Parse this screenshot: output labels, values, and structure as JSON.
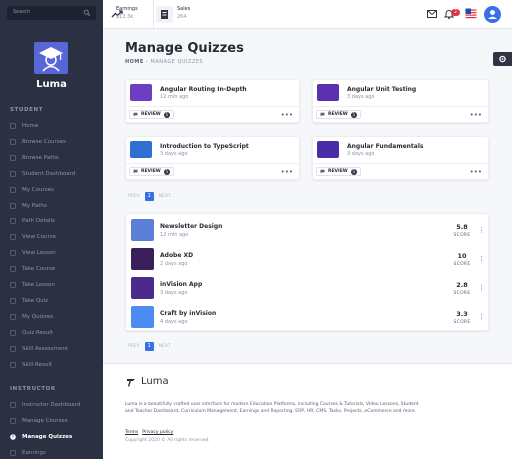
{
  "search": {
    "placeholder": "Search"
  },
  "brand": {
    "name": "Luma"
  },
  "sidebar": {
    "student_section": "STUDENT",
    "student_items": [
      {
        "label": "Home",
        "icon": "home-icon"
      },
      {
        "label": "Browse Courses",
        "icon": "local-library-icon"
      },
      {
        "label": "Browse Paths",
        "icon": "style-icon"
      },
      {
        "label": "Student Dashboard",
        "icon": "account-box-icon"
      },
      {
        "label": "My Courses",
        "icon": "search-icon"
      },
      {
        "label": "My Paths",
        "icon": "timeline-icon"
      },
      {
        "label": "Path Details",
        "icon": "change-history-icon"
      },
      {
        "label": "View Course",
        "icon": "face-icon"
      },
      {
        "label": "View Lesson",
        "icon": "panorama-fish-eye-icon"
      },
      {
        "label": "Take Course",
        "icon": "class-icon"
      },
      {
        "label": "Take Lesson",
        "icon": "import-contacts-icon"
      },
      {
        "label": "Take Quiz",
        "icon": "dvr-icon"
      },
      {
        "label": "My Quizzes",
        "icon": "poll-icon"
      },
      {
        "label": "Quiz Result",
        "icon": "live-help-icon"
      },
      {
        "label": "Skill Assessment",
        "icon": "layers-icon"
      },
      {
        "label": "Skill Result",
        "icon": "assignment-turned-in-icon"
      }
    ],
    "instructor_section": "INSTRUCTOR",
    "instructor_items": [
      {
        "label": "Instructor Dashboard",
        "icon": "school-icon",
        "active": false
      },
      {
        "label": "Manage Courses",
        "icon": "import-contacts-icon",
        "active": false
      },
      {
        "label": "Manage Quizzes",
        "icon": "help-icon",
        "active": true
      },
      {
        "label": "Earnings",
        "icon": "trending-up-icon",
        "active": false
      }
    ]
  },
  "topbar": {
    "earnings_label": "Earnings",
    "earnings_value": "$12.3k",
    "sales_label": "Sales",
    "sales_value": "264",
    "notifications_count": "2"
  },
  "page": {
    "title": "Manage Quizzes",
    "breadcrumb_home": "HOME",
    "breadcrumb_sep": " › ",
    "breadcrumb_current": "MANAGE QUIZZES"
  },
  "cards": [
    {
      "title": "Angular Routing In-Depth",
      "sub": "12 min ago",
      "review": "REVIEW",
      "count": "5",
      "thumb_color": "#6c3ec2"
    },
    {
      "title": "Angular Unit Testing",
      "sub": "3 days ago",
      "review": "REVIEW",
      "count": "5",
      "thumb_color": "#5a2fb0"
    },
    {
      "title": "Introduction to TypeScript",
      "sub": "3 days ago",
      "review": "REVIEW",
      "count": "5",
      "thumb_color": "#2f6fd3"
    },
    {
      "title": "Angular Fundamentals",
      "sub": "3 days ago",
      "review": "REVIEW",
      "count": "5",
      "thumb_color": "#4a2ca8"
    }
  ],
  "pager": {
    "prev": "PREV",
    "page": "1",
    "next": "NEXT"
  },
  "quizzes": [
    {
      "title": "Newsletter Design",
      "sub": "12 min ago",
      "score": "5.8",
      "score_label": "SCORE",
      "thumb_color": "#5b7fd6"
    },
    {
      "title": "Adobe XD",
      "sub": "2 days ago",
      "score": "10",
      "score_label": "SCORE",
      "thumb_color": "#3b1f5c"
    },
    {
      "title": "inVision App",
      "sub": "3 days ago",
      "score": "2.8",
      "score_label": "SCORE",
      "thumb_color": "#4b2a8c"
    },
    {
      "title": "Craft by inVision",
      "sub": "4 days ago",
      "score": "3.3",
      "score_label": "SCORE",
      "thumb_color": "#4a8cf0"
    }
  ],
  "footer": {
    "brand": "Luma",
    "description": "Luma is a beautifully crafted user interface for modern Education Platforms, including Courses & Tutorials, Video Lessons, Student and Teacher Dashboard, Curriculum Management, Earnings and Reporting, ERP, HR, CMS, Tasks, Projects, eCommerce and more.",
    "link_terms": "Terms",
    "link_privacy": "Privacy policy",
    "copyright": "Copyright 2020 © All rights reserved."
  },
  "colors": {
    "sidebar_bg": "#2b3142",
    "accent": "#3a6fe8",
    "brand_logo": "#5866d8"
  }
}
